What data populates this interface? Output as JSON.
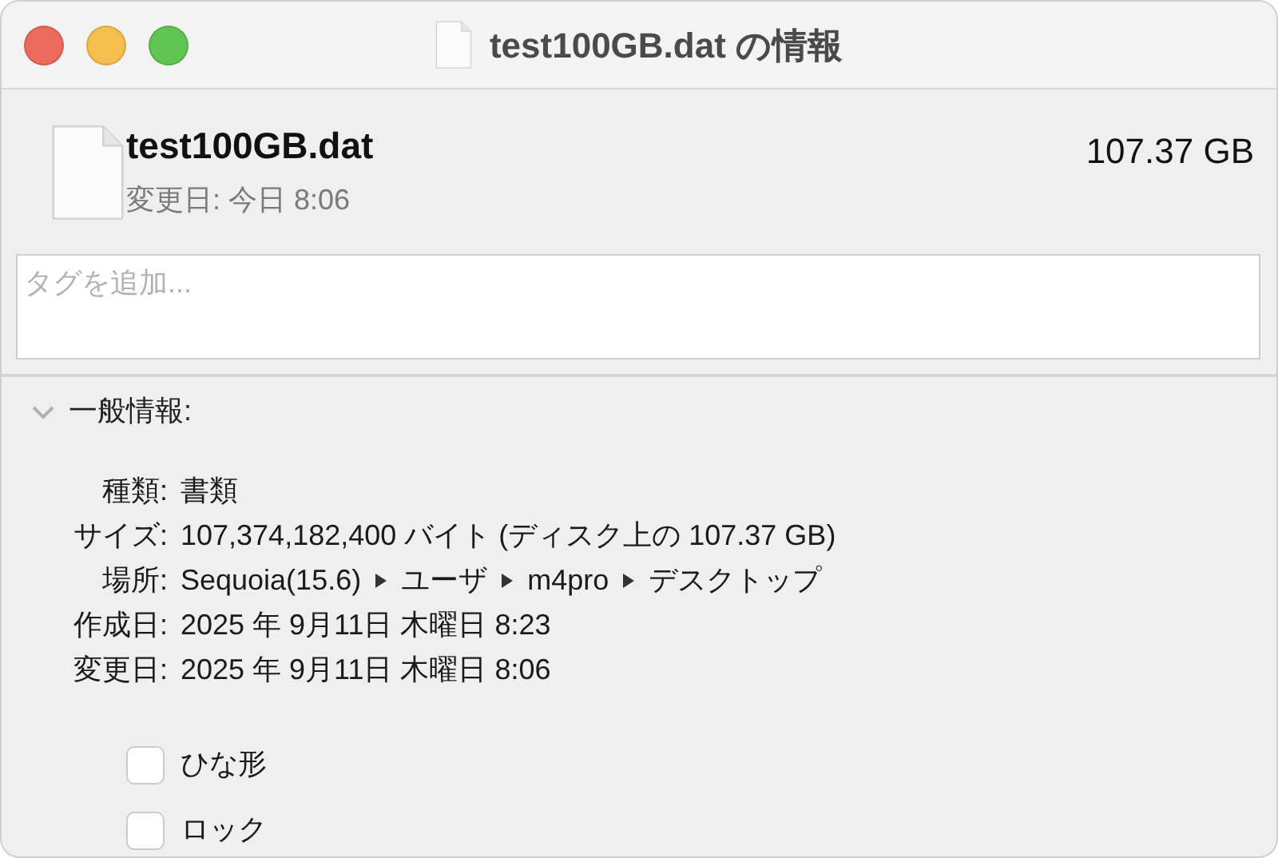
{
  "window": {
    "title": "test100GB.dat の情報"
  },
  "header": {
    "name": "test100GB.dat",
    "size": "107.37 GB",
    "modified": "変更日: 今日 8:06"
  },
  "tags": {
    "placeholder": "タグを追加..."
  },
  "section": {
    "title": "一般情報:",
    "expanded": true
  },
  "info": [
    {
      "kind": "text",
      "label": "種類:",
      "value": "書類"
    },
    {
      "kind": "text",
      "label": "サイズ:",
      "value": "107,374,182,400 バイト (ディスク上の 107.37 GB)"
    },
    {
      "kind": "path",
      "label": "場所:",
      "path": [
        "Sequoia(15.6)",
        "ユーザ",
        "m4pro",
        "デスクトップ"
      ]
    },
    {
      "kind": "text",
      "label": "作成日:",
      "value": "2025 年 9月11日 木曜日 8:23"
    },
    {
      "kind": "text",
      "label": "変更日:",
      "value": "2025 年 9月11日 木曜日 8:06"
    }
  ],
  "checkboxes": [
    {
      "label": "ひな形",
      "checked": false
    },
    {
      "label": "ロック",
      "checked": false
    }
  ]
}
